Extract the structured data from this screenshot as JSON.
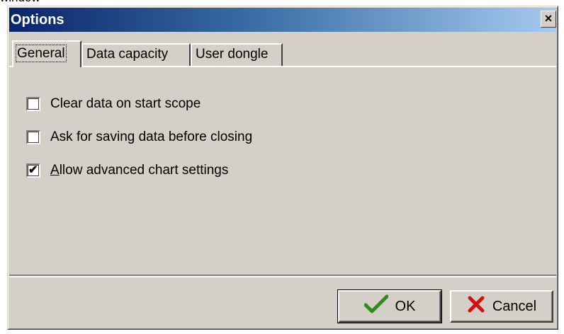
{
  "background_text": "window",
  "window": {
    "title": "Options",
    "close_glyph": "×"
  },
  "tabs": [
    {
      "label": "General",
      "active": true
    },
    {
      "label": "Data capacity",
      "active": false
    },
    {
      "label": "User dongle",
      "active": false
    }
  ],
  "options": [
    {
      "label": "Clear data on start scope",
      "checked": false
    },
    {
      "label": "Ask for saving data before closing",
      "checked": false
    },
    {
      "label_first": "A",
      "label_rest": "llow advanced chart settings",
      "checked": true
    }
  ],
  "buttons": {
    "ok_label": "OK",
    "cancel_label": "Cancel",
    "ok_icon": "green-checkmark-icon",
    "cancel_icon": "red-x-icon"
  },
  "colors": {
    "title_gradient_start": "#0a246a",
    "title_gradient_end": "#a6caf0",
    "face": "#d4d0c8",
    "ok_icon": "#2e8b1e",
    "cancel_icon": "#d21010"
  }
}
